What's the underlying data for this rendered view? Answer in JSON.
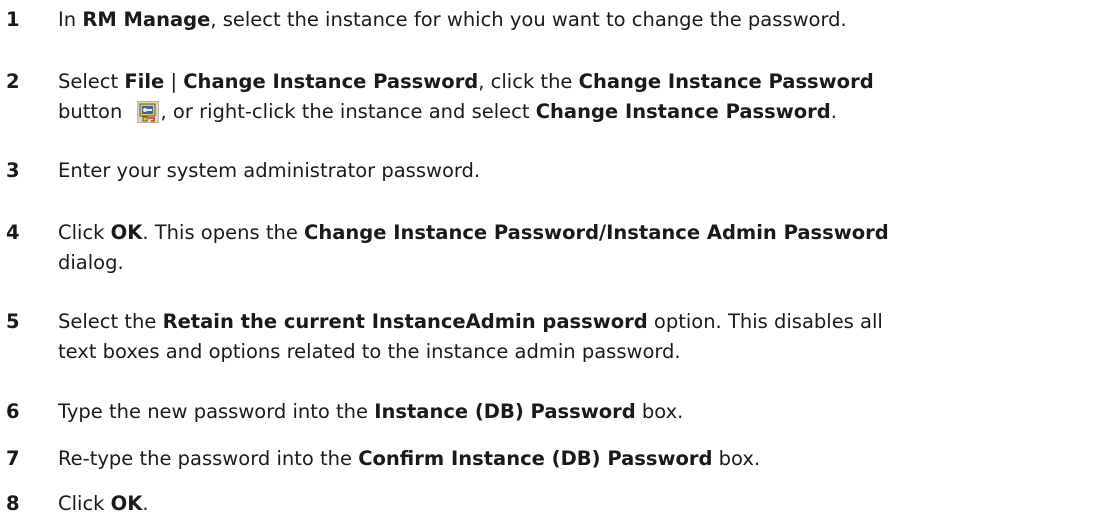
{
  "steps": [
    {
      "num": "1",
      "parts": [
        "In ",
        "RM Manage",
        ", select the instance for which you want to change the password."
      ]
    },
    {
      "num": "2",
      "line1": [
        "Select ",
        "File",
        " | ",
        "Change Instance Password",
        ", click the ",
        "Change Instance Password"
      ],
      "line2": [
        "button ",
        ", or right-click the instance and select ",
        "Change Instance Password",
        "."
      ],
      "icon": "change-instance-password-icon"
    },
    {
      "num": "3",
      "text": "Enter your system administrator password."
    },
    {
      "num": "4",
      "line1": [
        "Click ",
        "OK",
        ". This opens the ",
        "Change Instance Password/Instance Admin Password"
      ],
      "line2": "dialog."
    },
    {
      "num": "5",
      "line1": [
        "Select the ",
        "Retain the current InstanceAdmin password",
        " option. This disables all"
      ],
      "line2": "text boxes and options related to the instance admin password."
    },
    {
      "num": "6",
      "parts": [
        "Type the new password into the ",
        "Instance (DB) Password",
        " box."
      ]
    },
    {
      "num": "7",
      "parts": [
        "Re-type the password into the ",
        "Confirm Instance (DB) Password",
        " box."
      ]
    },
    {
      "num": "8",
      "parts": [
        "Click ",
        "OK",
        "."
      ]
    }
  ]
}
